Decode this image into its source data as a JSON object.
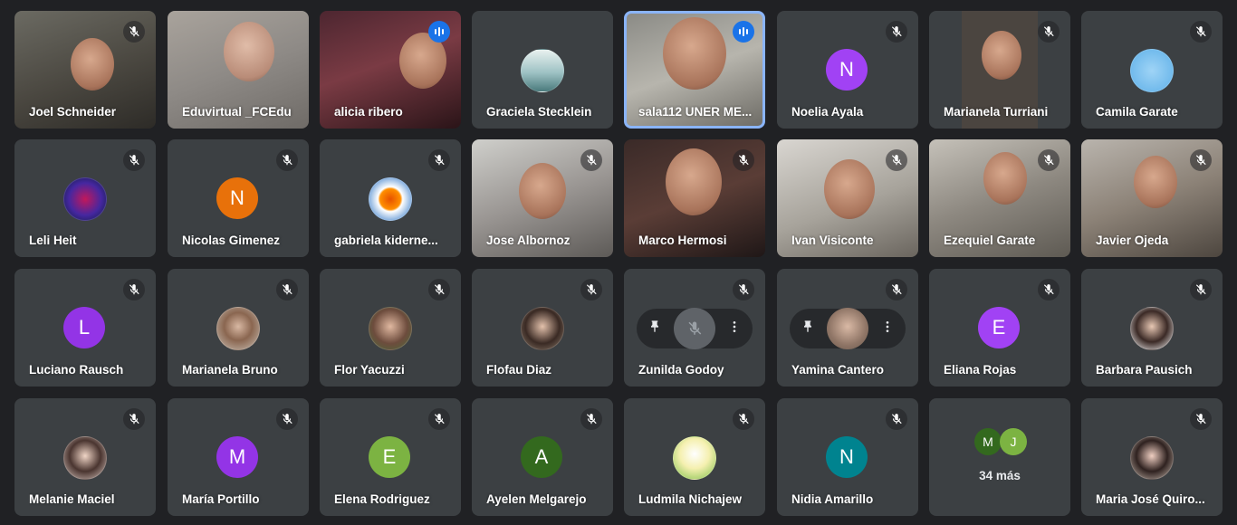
{
  "colors": {
    "background": "#202124",
    "tile": "#3c4043",
    "active_border": "#8ab4f8",
    "speaking": "#1a73e8"
  },
  "participants": [
    "Joel Schneider",
    "Eduvirtual _FCEdu",
    "alicia ribero",
    "Graciela Stecklein",
    "sala112 UNER ME...",
    "Noelia Ayala",
    "Marianela Turriani",
    "Camila Garate",
    "Leli Heit",
    "Nicolas Gimenez",
    "gabriela kiderne...",
    "Jose Albornoz",
    "Marco Hermosi",
    "Ivan Visiconte",
    "Ezequiel Garate",
    "Javier Ojeda",
    "Luciano Rausch",
    "Marianela Bruno",
    "Flor Yacuzzi",
    "Flofau Diaz",
    "Zunilda Godoy",
    "Yamina Cantero",
    "Eliana Rojas",
    "Barbara Pausich",
    "Melanie Maciel",
    "María Portillo",
    "Elena Rodriguez",
    "Ayelen Melgarejo",
    "Ludmila Nichajew",
    "Nidia Amarillo",
    "Maria José Quiro..."
  ],
  "initials": {
    "noelia": "N",
    "nicolas": "N",
    "luciano": "L",
    "eliana": "E",
    "maria_portillo": "M",
    "elena": "E",
    "ayelen": "A",
    "nidia": "N"
  },
  "avatar_colors": {
    "purple": "#9334e6",
    "orange": "#e8710a",
    "violet_lt": "#a142f4",
    "green": "#7cb342",
    "green_dk": "#33691e",
    "teal": "#00838f"
  },
  "others": {
    "count_label": "34 más",
    "initial_1": "M",
    "initial_2": "J"
  },
  "icons": {
    "mic_off": "mic-off-icon",
    "speaking": "audio-level-icon",
    "pin": "pin-icon",
    "more": "more-vert-icon"
  }
}
